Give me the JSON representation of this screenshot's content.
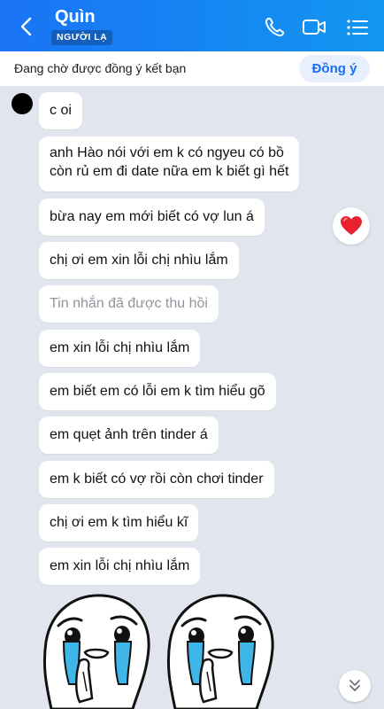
{
  "header": {
    "title": "Quìn",
    "badge": "NGƯỜI LẠ"
  },
  "friend_request": {
    "text": "Đang chờ được đồng ý kết bạn",
    "accept_label": "Đồng ý"
  },
  "messages": [
    "c oi",
    "anh Hào nói với em k có ngyeu có bồ\ncòn rủ em đi date nữa em k biết gì hết",
    "bừa nay em mới biết có vợ lun á",
    "chị ơi em xin lỗi chị nhìu lắm",
    "Tin nhắn đã được thu hồi",
    "em xin lỗi chị nhìu lắm",
    "em biết em có lỗi em k tìm hiểu gõ",
    "em quẹt ảnh trên tinder á",
    "em k biết có vợ rồi còn chơi tinder",
    "chị ơi em k tìm hiểu kĩ",
    "em xin lỗi chị nhìu lắm"
  ],
  "reaction": "heart",
  "colors": {
    "header_start": "#1a73f5",
    "header_end": "#1296f0",
    "chat_bg": "#e1e6ee",
    "accent": "#1a6ef2",
    "heart": "#e8232f"
  }
}
